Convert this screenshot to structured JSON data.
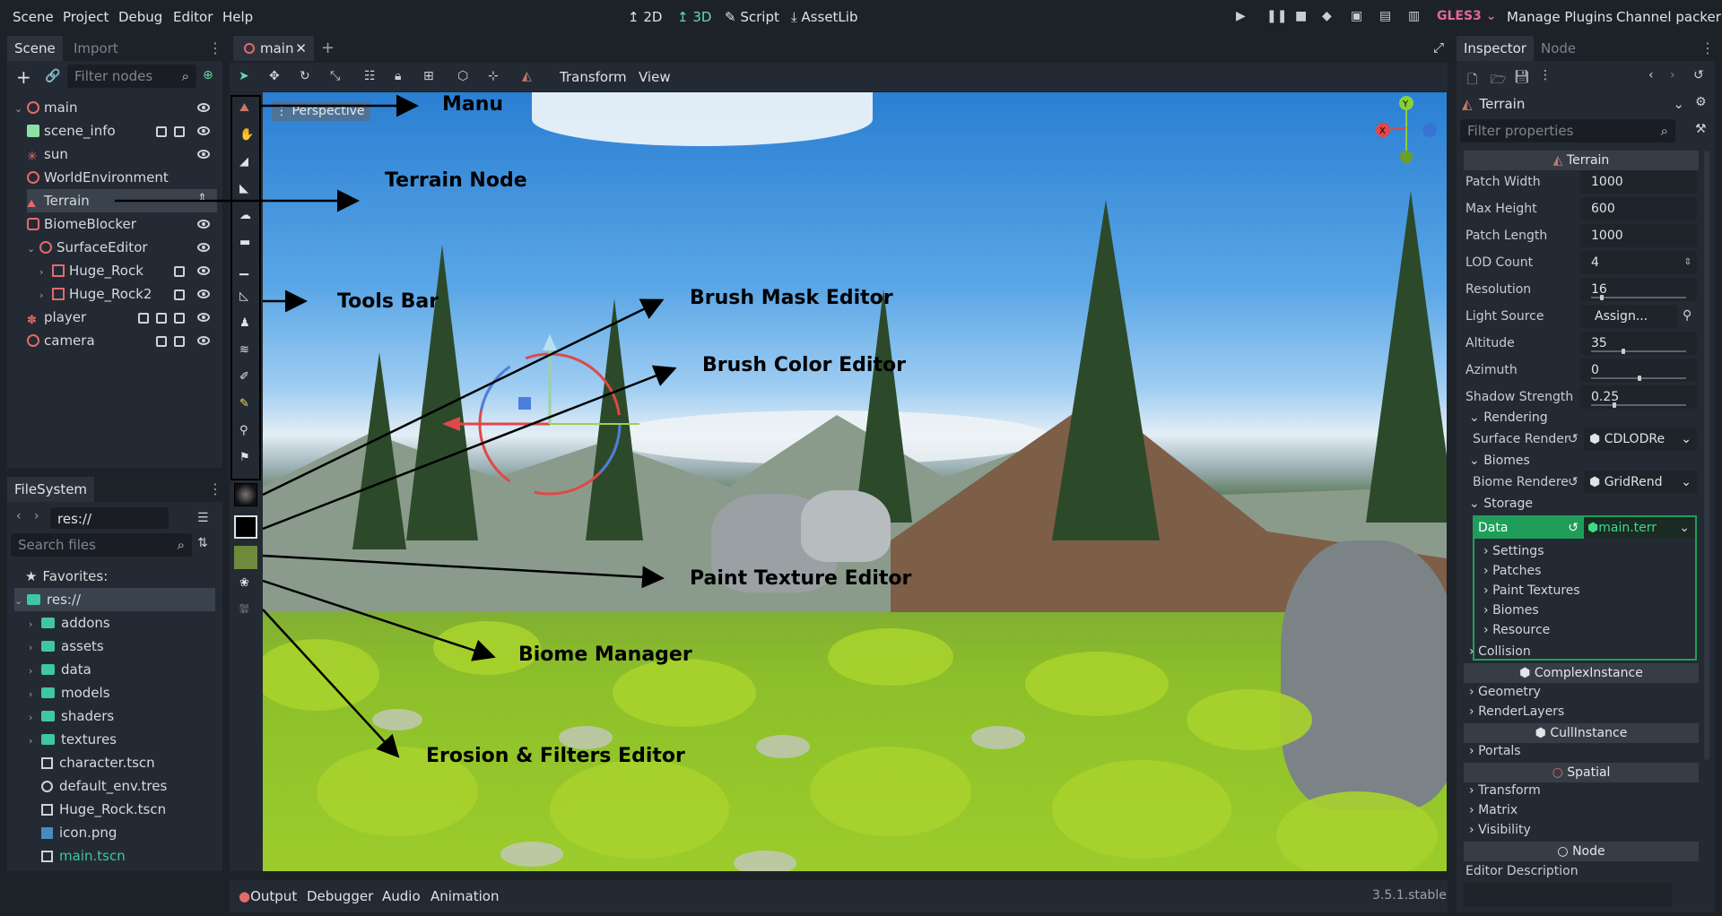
{
  "menu": [
    "Scene",
    "Project",
    "Debug",
    "Editor",
    "Help"
  ],
  "modes": [
    {
      "label": "2D",
      "icon": "2d-icon",
      "active": false
    },
    {
      "label": "3D",
      "icon": "3d-icon",
      "active": true
    },
    {
      "label": "Script",
      "icon": "script-icon",
      "active": false
    },
    {
      "label": "AssetLib",
      "icon": "assetlib-icon",
      "active": false
    }
  ],
  "top_right": {
    "renderer": "GLES3",
    "manage_plugins": "Manage Plugins",
    "channel_packer": "Channel packer"
  },
  "scene_dock": {
    "tabs": [
      "Scene",
      "Import"
    ],
    "filter_placeholder": "Filter nodes",
    "nodes": [
      {
        "label": "main"
      },
      {
        "label": "scene_info"
      },
      {
        "label": "sun"
      },
      {
        "label": "WorldEnvironment"
      },
      {
        "label": "Terrain"
      },
      {
        "label": "BiomeBlocker"
      },
      {
        "label": "SurfaceEditor"
      },
      {
        "label": "Huge_Rock"
      },
      {
        "label": "Huge_Rock2"
      },
      {
        "label": "player"
      },
      {
        "label": "camera"
      }
    ]
  },
  "filesystem": {
    "tab": "FileSystem",
    "path": "res://",
    "search_placeholder": "Search files",
    "favorites": "Favorites:",
    "root": "res://",
    "folders": [
      "addons",
      "assets",
      "data",
      "models",
      "shaders",
      "textures"
    ],
    "files": [
      "character.tscn",
      "default_env.tres",
      "Huge_Rock.tscn",
      "icon.png",
      "main.tscn"
    ]
  },
  "editor_tab": "main",
  "viewport_toolbar": {
    "transform": "Transform",
    "view": "View",
    "perspective": "Perspective"
  },
  "annotations": {
    "menu": "Manu",
    "terrain_node": "Terrain Node",
    "tools_bar": "Tools Bar",
    "brush_mask": "Brush Mask Editor",
    "brush_color": "Brush Color Editor",
    "paint_texture": "Paint Texture Editor",
    "biome_manager": "Biome Manager",
    "erosion": "Erosion & Filters Editor"
  },
  "bottom": {
    "tabs": [
      "Output",
      "Debugger",
      "Audio",
      "Animation"
    ],
    "version": "3.5.1.stable"
  },
  "inspector": {
    "tabs": [
      "Inspector",
      "Node"
    ],
    "object": "Terrain",
    "filter_placeholder": "Filter properties",
    "class_header": "Terrain",
    "properties": [
      {
        "label": "Patch Width",
        "value": "1000"
      },
      {
        "label": "Max Height",
        "value": "600"
      },
      {
        "label": "Patch Length",
        "value": "1000"
      },
      {
        "label": "LOD Count",
        "value": "4"
      },
      {
        "label": "Resolution",
        "value": "16"
      },
      {
        "label": "Light Source",
        "value": "Assign..."
      },
      {
        "label": "Altitude",
        "value": "35"
      },
      {
        "label": "Azimuth",
        "value": "0"
      },
      {
        "label": "Shadow Strength",
        "value": "0.25"
      }
    ],
    "rendering": "Rendering",
    "surface_render_label": "Surface Render",
    "surface_render_value": "CDLODRe",
    "biomes": "Biomes",
    "biome_render_label": "Biome Rendere",
    "biome_render_value": "GridRend",
    "storage": "Storage",
    "data_label": "Data",
    "data_value": "main.terr",
    "data_sub": [
      "Settings",
      "Patches",
      "Paint Textures",
      "Biomes",
      "Resource"
    ],
    "collision": "Collision",
    "complex_instance": "ComplexInstance",
    "geometry": "Geometry",
    "render_layers": "RenderLayers",
    "cull_instance": "CullInstance",
    "portals": "Portals",
    "spatial": "Spatial",
    "transform": "Transform",
    "matrix": "Matrix",
    "visibility": "Visibility",
    "node": "Node",
    "editor_description": "Editor Description"
  },
  "colors": {
    "accent": "#66d9b3",
    "renderer": "#e3689c",
    "bg": "#1d2229",
    "panel": "#242a33",
    "data_green": "#1f9e5a"
  }
}
